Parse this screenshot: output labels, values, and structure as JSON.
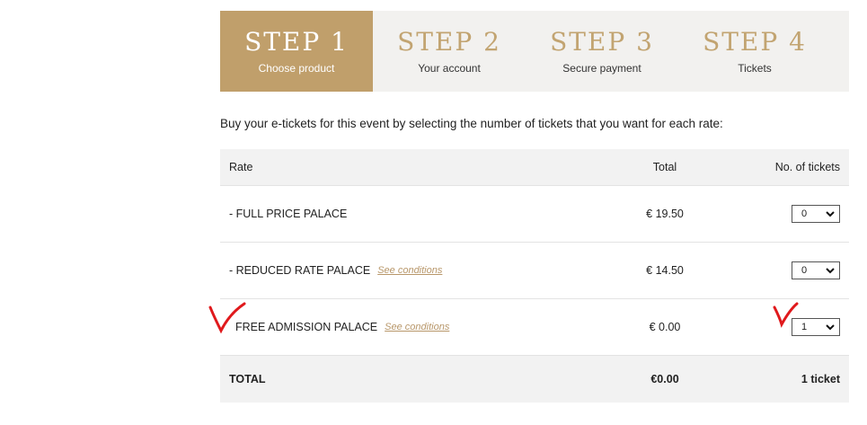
{
  "steps": [
    {
      "title": "STEP 1",
      "subtitle": "Choose product"
    },
    {
      "title": "STEP 2",
      "subtitle": "Your account"
    },
    {
      "title": "STEP 3",
      "subtitle": "Secure payment"
    },
    {
      "title": "STEP 4",
      "subtitle": "Tickets"
    }
  ],
  "intro": "Buy your e-tickets for this event by selecting the number of tickets that you want for each rate:",
  "table": {
    "headers": {
      "rate": "Rate",
      "total": "Total",
      "tickets": "No. of tickets"
    },
    "rows": [
      {
        "rate": "- FULL PRICE PALACE",
        "conditions": "",
        "price": "€ 19.50",
        "qty": "0"
      },
      {
        "rate": "- REDUCED RATE PALACE",
        "conditions": "See conditions",
        "price": "€ 14.50",
        "qty": "0"
      },
      {
        "rate": "FREE ADMISSION PALACE",
        "conditions": "See conditions",
        "price": "€ 0.00",
        "qty": "1"
      }
    ],
    "total": {
      "label": "TOTAL",
      "amount": "€0.00",
      "count": "1 ticket"
    }
  },
  "colors": {
    "accent": "#c09f6b",
    "link": "#b8976a",
    "annotation": "#e0191c"
  },
  "icons": {
    "select_arrow": "chevron-down-icon",
    "annotation": "red-checkmark"
  }
}
